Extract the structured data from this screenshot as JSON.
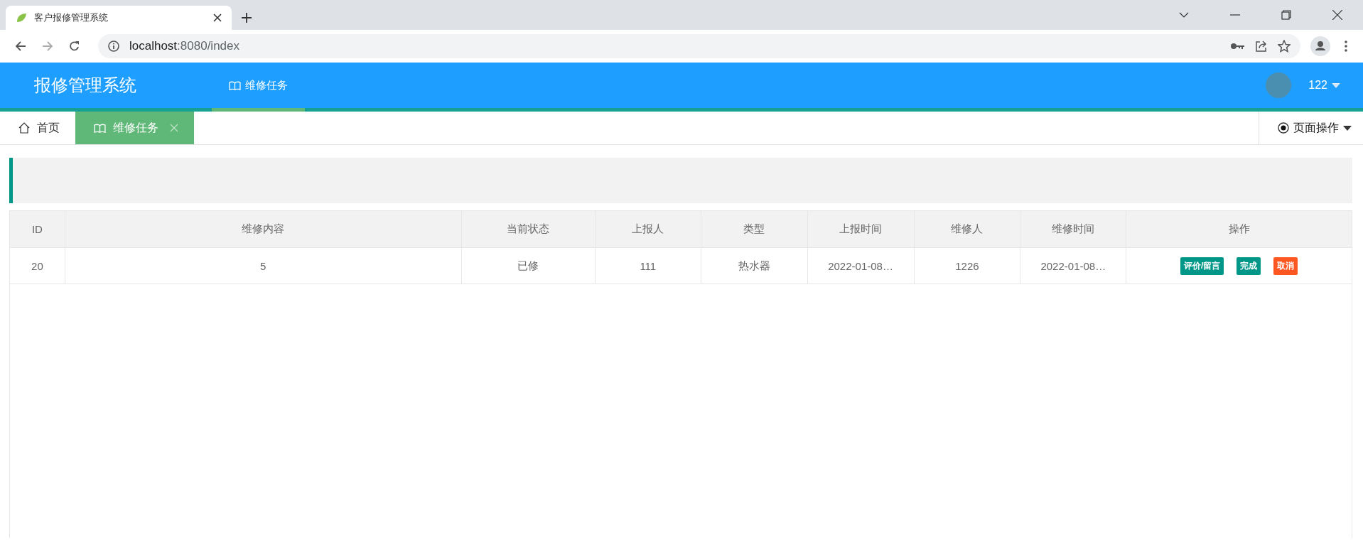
{
  "browser": {
    "tab_title": "客户报修管理系统",
    "url_host": "localhost",
    "url_rest": ":8080/index"
  },
  "header": {
    "title": "报修管理系统",
    "nav": [
      {
        "label": "维修任务",
        "selected": true
      }
    ],
    "user": "122"
  },
  "page_tabs": [
    {
      "kind": "home",
      "label": "首页",
      "selected": false,
      "closable": false
    },
    {
      "kind": "book",
      "label": "维修任务",
      "selected": true,
      "closable": true
    }
  ],
  "page_ops": "页面操作",
  "table": {
    "columns": [
      "ID",
      "维修内容",
      "当前状态",
      "上报人",
      "类型",
      "上报时间",
      "维修人",
      "维修时间",
      "操作"
    ],
    "rows": [
      {
        "cells": [
          "20",
          "5",
          "已修",
          "111",
          "热水器",
          "2022-01-08…",
          "1226",
          "2022-01-08…"
        ],
        "actions": [
          {
            "label": "评价/留言",
            "color": "#009688"
          },
          {
            "label": "完成",
            "color": "#009688"
          },
          {
            "label": "取消",
            "color": "#ff5722"
          }
        ]
      }
    ]
  }
}
